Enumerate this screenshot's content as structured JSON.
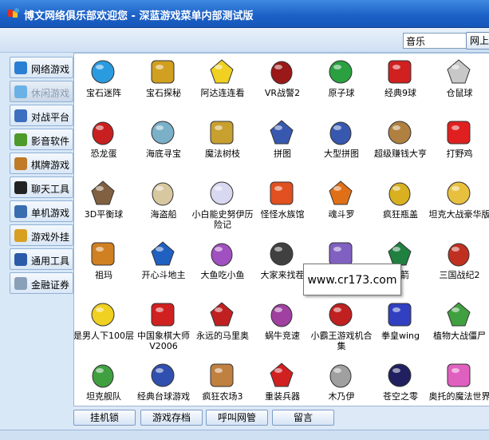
{
  "window": {
    "title": "博文网络俱乐部欢迎您 - 深蓝游戏菜单内部测试版"
  },
  "search": {
    "value": "音乐",
    "button_label": "网上"
  },
  "sidebar": {
    "items": [
      {
        "label": "网络游戏",
        "icon": "diamond-icon",
        "color": "#2a7fd4"
      },
      {
        "label": "休闲游戏",
        "icon": "diamond-icon",
        "color": "#6ab2e6",
        "active": true
      },
      {
        "label": "对战平台",
        "icon": "shield-icon",
        "color": "#3c6fc0"
      },
      {
        "label": "影音软件",
        "icon": "disc-icon",
        "color": "#4c9a2a"
      },
      {
        "label": "棋牌游戏",
        "icon": "person-icon",
        "color": "#c07a28"
      },
      {
        "label": "聊天工具",
        "icon": "penguin-icon",
        "color": "#222222"
      },
      {
        "label": "单机游戏",
        "icon": "runner-icon",
        "color": "#3a6cb0"
      },
      {
        "label": "游戏外挂",
        "icon": "star-icon",
        "color": "#d8a020"
      },
      {
        "label": "通用工具",
        "icon": "word-icon",
        "color": "#2b5aa8"
      },
      {
        "label": "金融证券",
        "icon": "hand-icon",
        "color": "#8aa0b8"
      }
    ]
  },
  "games": [
    {
      "label": "宝石迷阵",
      "icon": "gem-icon",
      "color": "#2b9be0"
    },
    {
      "label": "宝石探秘",
      "icon": "gold-mask-icon",
      "color": "#d2a020"
    },
    {
      "label": "阿达连连看",
      "icon": "yellow-dog-icon",
      "color": "#f0d020"
    },
    {
      "label": "VR战警2",
      "icon": "red-box-icon",
      "color": "#9a1818"
    },
    {
      "label": "原子球",
      "icon": "atom-ball-icon",
      "color": "#2aa040"
    },
    {
      "label": "经典9球",
      "icon": "billiard-icon",
      "color": "#d02020"
    },
    {
      "label": "仓鼠球",
      "icon": "hamster-icon",
      "color": "#c8c8c8"
    },
    {
      "label": "恐龙蛋",
      "icon": "dino-egg-icon",
      "color": "#c82020"
    },
    {
      "label": "海底寻宝",
      "icon": "fish-icon",
      "color": "#7ab0c8"
    },
    {
      "label": "魔法树枝",
      "icon": "gold-heart-icon",
      "color": "#c8a030"
    },
    {
      "label": "拼图",
      "icon": "girl-face-icon",
      "color": "#3858b0"
    },
    {
      "label": "大型拼图",
      "icon": "girl-face-icon",
      "color": "#3858b0"
    },
    {
      "label": "超级赚钱大亨",
      "icon": "money-bag-icon",
      "color": "#b08040"
    },
    {
      "label": "打野鸡",
      "icon": "number-two-icon",
      "color": "#e02020"
    },
    {
      "label": "3D平衡球",
      "icon": "balance-ball-icon",
      "color": "#806040"
    },
    {
      "label": "海盗船",
      "icon": "skull-icon",
      "color": "#d8c8a0"
    },
    {
      "label": "小白能史努伊历险记",
      "icon": "mouse-icon",
      "color": "#d8d8f0"
    },
    {
      "label": "怪怪水族馆",
      "icon": "red-fish-icon",
      "color": "#e05020"
    },
    {
      "label": "魂斗罗",
      "icon": "swirl-icon",
      "color": "#e07018"
    },
    {
      "label": "疯狂瓶盖",
      "icon": "bottle-cap-icon",
      "color": "#d8b020"
    },
    {
      "label": "坦克大战豪华版",
      "icon": "tank-star-icon",
      "color": "#e8c040"
    },
    {
      "label": "祖玛",
      "icon": "zuma-icon",
      "color": "#d08020"
    },
    {
      "label": "开心斗地主",
      "icon": "cards-icon",
      "color": "#2060c0"
    },
    {
      "label": "大鱼吃小鱼",
      "icon": "purple-fish-icon",
      "color": "#a050c0"
    },
    {
      "label": "大家来找茬",
      "icon": "number-five-icon",
      "color": "#404040"
    },
    {
      "label": "",
      "icon": "character-icon",
      "color": "#8060c0"
    },
    {
      "label": "火箭",
      "icon": "rocket-icon",
      "color": "#208040"
    },
    {
      "label": "三国战纪2",
      "icon": "three-kingdoms-icon",
      "color": "#c03020"
    },
    {
      "label": "是男人下100层",
      "icon": "yellow-face-icon",
      "color": "#f0d020"
    },
    {
      "label": "中国象棋大师V2006",
      "icon": "chess-icon",
      "color": "#d02020"
    },
    {
      "label": "永远的马里奥",
      "icon": "mario-icon",
      "color": "#c02020"
    },
    {
      "label": "蜗牛竞速",
      "icon": "snail-icon",
      "color": "#a040a0"
    },
    {
      "label": "小霸王游戏机合集",
      "icon": "game-console-icon",
      "color": "#c02020"
    },
    {
      "label": "拳皇wing",
      "icon": "fighter-icon",
      "color": "#3040c0"
    },
    {
      "label": "植物大战僵尸",
      "icon": "plant-icon",
      "color": "#40a040"
    },
    {
      "label": "坦克舰队",
      "icon": "green-tank-icon",
      "color": "#40a040"
    },
    {
      "label": "经典台球游戏",
      "icon": "pool-icon",
      "color": "#3050b0"
    },
    {
      "label": "疯狂农场3",
      "icon": "farmer-icon",
      "color": "#c08040"
    },
    {
      "label": "重装兵器",
      "icon": "radiation-icon",
      "color": "#d02020"
    },
    {
      "label": "木乃伊",
      "icon": "mummy-icon",
      "color": "#a0a0a0"
    },
    {
      "label": "苍空之零",
      "icon": "starfield-icon",
      "color": "#202060"
    },
    {
      "label": "奥托的魔法世界",
      "icon": "pink-creature-icon",
      "color": "#e060c0"
    }
  ],
  "tooltip": {
    "text": "www.cr173.com"
  },
  "bottom_buttons": [
    {
      "label": "挂机锁"
    },
    {
      "label": "游戏存档"
    },
    {
      "label": "呼叫网管"
    },
    {
      "label": "留言"
    }
  ]
}
